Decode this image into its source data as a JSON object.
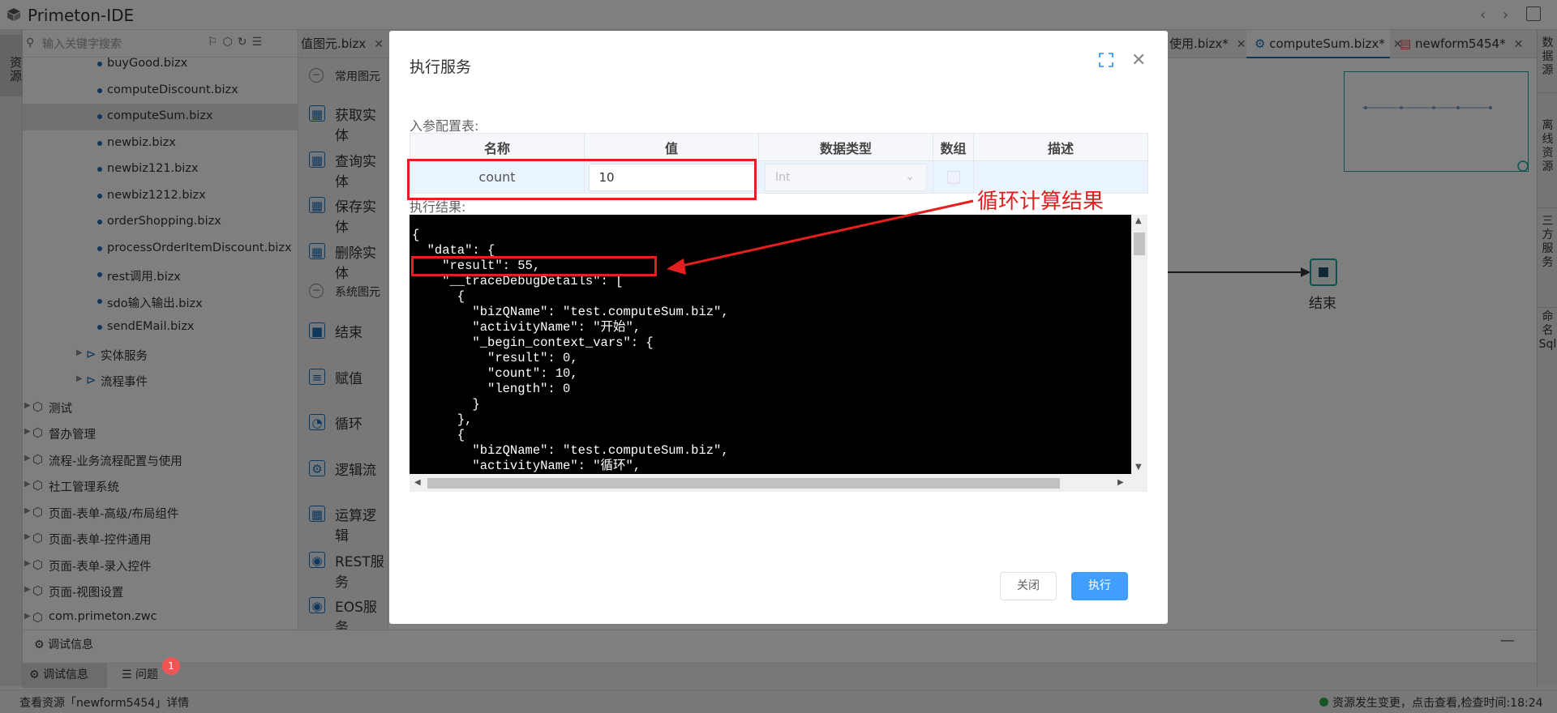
{
  "app": {
    "title": "Primeton-IDE"
  },
  "left_bar": {
    "tab": "资源"
  },
  "explorer": {
    "search_placeholder": "输入关键字搜索",
    "files": [
      "buyGood.bizx",
      "computeDiscount.bizx",
      "computeSum.bizx",
      "newbiz.bizx",
      "newbiz121.bizx",
      "newbiz1212.bizx",
      "orderShopping.bizx",
      "processOrderItemDiscount.bizx",
      "rest调用.bizx",
      "sdo输入输出.bizx",
      "sendEMail.bizx"
    ],
    "selected_file": "computeSum.bizx",
    "sub_folders": [
      "实体服务",
      "流程事件"
    ],
    "projects": [
      "测试",
      "督办管理",
      "流程-业务流程配置与使用",
      "社工管理系统",
      "页面-表单-高级/布局组件",
      "页面-表单-控件通用",
      "页面-表单-录入控件",
      "页面-视图设置",
      "com.primeton.zwc"
    ]
  },
  "tabs": [
    {
      "label": "值图元.bizx"
    },
    {
      "label": "使用.bizx*"
    },
    {
      "label": "computeSum.bizx*"
    },
    {
      "label": "newform5454*"
    }
  ],
  "palette": {
    "common_section": "常用图元",
    "common_items": [
      "获取实体",
      "查询实体",
      "保存实体",
      "删除实体"
    ],
    "system_section": "系统图元",
    "system_items": [
      "结束",
      "赋值",
      "循环",
      "逻辑流",
      "运算逻辑",
      "REST服务",
      "EOS服务"
    ]
  },
  "right_bar": {
    "tabs": [
      "数据源",
      "离线资源",
      "三方服务",
      "命名Sql"
    ]
  },
  "canvas": {
    "end_node_label": "结束"
  },
  "bottom": {
    "panel_title": "调试信息",
    "tab_debug": "调试信息",
    "tab_problems": "问题",
    "problem_count": "1"
  },
  "status": {
    "left": "查看资源「newform5454」详情",
    "right": "资源发生变更，点击查看,检查时间:18:24"
  },
  "dialog": {
    "title": "执行服务",
    "input_label": "入参配置表:",
    "columns": [
      "名称",
      "值",
      "数据类型",
      "数组",
      "描述"
    ],
    "row": {
      "name": "count",
      "value": "10",
      "type": "Int",
      "desc": ""
    },
    "result_label": "执行结果:",
    "result_text": "{\n  \"data\": {\n    \"result\": 55,\n    \"__traceDebugDetails\": [\n      {\n        \"bizQName\": \"test.computeSum.biz\",\n        \"activityName\": \"开始\",\n        \"_begin_context_vars\": {\n          \"result\": 0,\n          \"count\": 10,\n          \"length\": 0\n        }\n      },\n      {\n        \"bizQName\": \"test.computeSum.biz\",\n        \"activityName\": \"循环\",",
    "close_button": "关闭",
    "run_button": "执行"
  },
  "annotation": {
    "text": "循环计算结果",
    "color": "#e41f1f"
  },
  "colors": {
    "accent": "#409eff",
    "brand": "#1e6fb8",
    "annotation": "#e41f1f"
  }
}
